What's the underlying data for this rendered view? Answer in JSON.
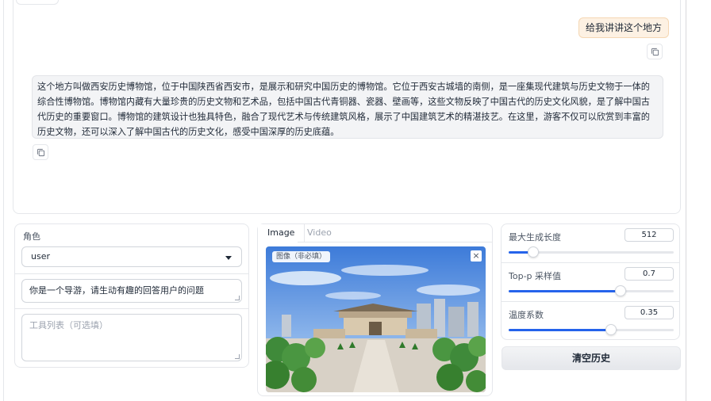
{
  "chat": {
    "user_message": "给我讲讲这个地方",
    "bot_message": "这个地方叫做西安历史博物馆，位于中国陕西省西安市，是展示和研究中国历史的博物馆。它位于西安古城墙的南侧，是一座集现代建筑与历史文物于一体的综合性博物馆。博物馆内藏有大量珍贵的历史文物和艺术品，包括中国古代青铜器、瓷器、壁画等，这些文物反映了中国古代的历史文化风貌，是了解中国古代历史的重要窗口。博物馆的建筑设计也独具特色，融合了现代艺术与传统建筑风格，展示了中国建筑艺术的精湛技艺。在这里，游客不仅可以欣赏到丰富的历史文物，还可以深入了解中国古代的历史文化，感受中国深厚的历史底蕴。"
  },
  "left": {
    "role_label": "角色",
    "role_value": "user",
    "system_prompt": "你是一个导游，请生动有趣的回答用户的问题",
    "tools_placeholder": "工具列表（可选填）"
  },
  "media": {
    "tabs": [
      "Image",
      "Video"
    ],
    "image_label": "图像（非必填）",
    "close_glyph": "×"
  },
  "params": {
    "max_tokens": {
      "label": "最大生成长度",
      "value": "512",
      "fraction": 0.15
    },
    "top_p": {
      "label": "Top-p 采样值",
      "value": "0.7",
      "fraction": 0.68
    },
    "temperature": {
      "label": "温度系数",
      "value": "0.35",
      "fraction": 0.62
    }
  },
  "clear_button": "清空历史",
  "colors": {
    "accent": "#2563eb",
    "user_bubble": "#fdf1e3",
    "bot_bubble": "#f3f4f6"
  }
}
